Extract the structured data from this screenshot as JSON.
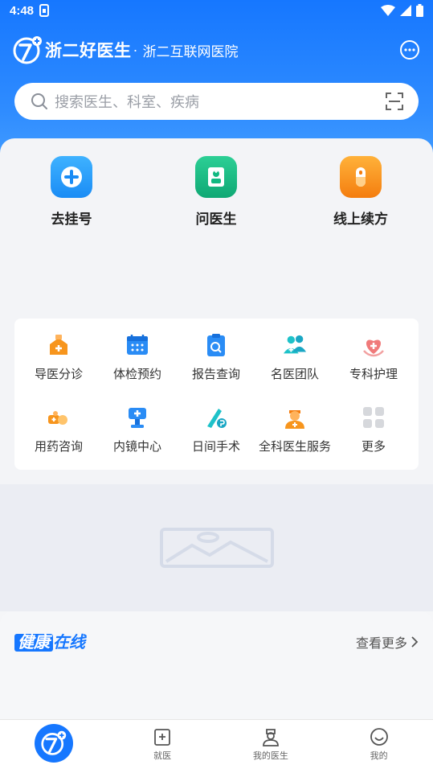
{
  "status_bar": {
    "time": "4:48"
  },
  "header": {
    "app_name": "浙二好医生",
    "separator": "·",
    "hospital_name": "浙二互联网医院"
  },
  "search": {
    "placeholder": "搜索医生、科室、疾病"
  },
  "quick_actions": [
    {
      "label": "去挂号",
      "icon": "plus-cross-icon",
      "color": "#2a9dfc"
    },
    {
      "label": "问医生",
      "icon": "doctor-icon",
      "color": "#12b981"
    },
    {
      "label": "线上续方",
      "icon": "pill-capsule-icon",
      "color": "#f7951d"
    }
  ],
  "services": [
    {
      "label": "导医分诊",
      "icon": "triage-icon"
    },
    {
      "label": "体检预约",
      "icon": "calendar-icon"
    },
    {
      "label": "报告查询",
      "icon": "report-search-icon"
    },
    {
      "label": "名医团队",
      "icon": "team-icon"
    },
    {
      "label": "专科护理",
      "icon": "care-heart-icon"
    },
    {
      "label": "用药咨询",
      "icon": "medicine-icon"
    },
    {
      "label": "内镜中心",
      "icon": "endoscope-icon"
    },
    {
      "label": "日间手术",
      "icon": "surgery-icon"
    },
    {
      "label": "全科医生服务",
      "icon": "general-doctor-icon"
    },
    {
      "label": "更多",
      "icon": "grid-more-icon"
    }
  ],
  "health_section": {
    "title_part1": "健康",
    "title_part2": "在线",
    "more_label": "查看更多"
  },
  "tabbar": {
    "tabs": [
      {
        "label": ""
      },
      {
        "label": "就医"
      },
      {
        "label": "我的医生"
      },
      {
        "label": "我的"
      }
    ]
  },
  "colors": {
    "primary": "#1677ff",
    "accent_orange": "#f7951d",
    "accent_green": "#12b981"
  }
}
